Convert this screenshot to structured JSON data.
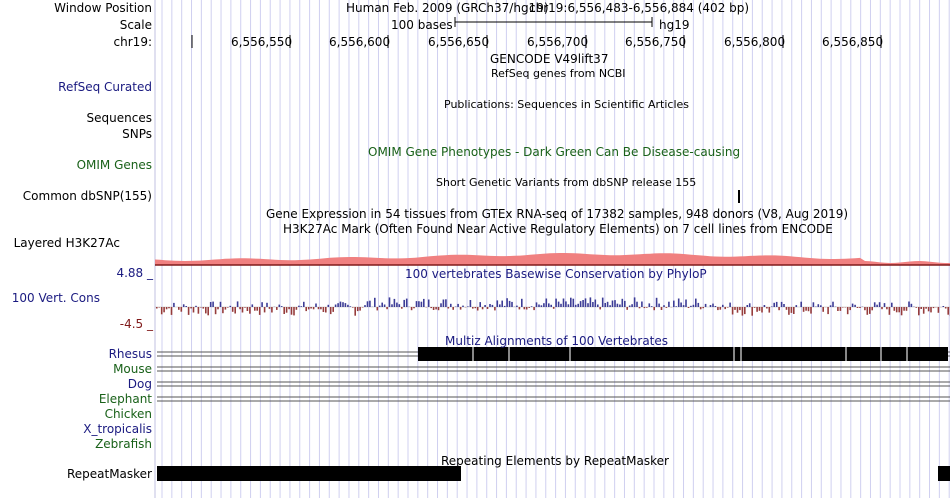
{
  "header": {
    "window_position_label": "Window Position",
    "scale_label": "Scale",
    "chrom_label": "chr19:",
    "assembly": "Human Feb. 2009 (GRCh37/hg19)",
    "position": "chr19:6,556,483-6,556,884 (402 bp)",
    "scale_text": "100 bases",
    "scale_db": "hg19",
    "ticks": [
      "6,556,550",
      "6,556,600",
      "6,556,650",
      "6,556,700",
      "6,556,750",
      "6,556,800",
      "6,556,850"
    ]
  },
  "tracks": {
    "gencode_title": "GENCODE V49lift37",
    "refseq_title": "RefSeq genes from NCBI",
    "refseq_label": "RefSeq Curated",
    "pubs_title": "Publications: Sequences in Scientific Articles",
    "sequences_label": "Sequences",
    "snps_label": "SNPs",
    "omim_title": "OMIM Gene Phenotypes - Dark Green Can Be Disease-causing",
    "omim_label": "OMIM Genes",
    "dbsnp_title": "Short Genetic Variants from dbSNP release 155",
    "dbsnp_label": "Common dbSNP(155)",
    "gtex_title": "Gene Expression in 54 tissues from GTEx RNA-seq of 17382 samples, 948 donors (V8, Aug 2019)",
    "h3k_title": "H3K27Ac Mark (Often Found Near Active Regulatory Elements) on 7 cell lines from ENCODE",
    "h3k_label": "Layered H3K27Ac",
    "cons_title": "100 vertebrates Basewise Conservation by PhyloP",
    "cons_label": "100 Vert. Cons",
    "cons_max": "4.88 _",
    "cons_min": "-4.5 _",
    "multiz_title": "Multiz Alignments of 100 Vertebrates",
    "species": [
      {
        "name": "Rhesus",
        "color": "#1a1a80"
      },
      {
        "name": "Mouse",
        "color": "#196119"
      },
      {
        "name": "Dog",
        "color": "#1a1a80"
      },
      {
        "name": "Elephant",
        "color": "#196119"
      },
      {
        "name": "Chicken",
        "color": "#196119"
      },
      {
        "name": "X_tropicalis",
        "color": "#1a1a80"
      },
      {
        "name": "Zebrafish",
        "color": "#196119"
      }
    ],
    "rmsk_title": "Repeating Elements by RepeatMasker",
    "rmsk_label": "RepeatMasker"
  },
  "colors": {
    "label_blue": "#1a1a80",
    "label_green": "#196119",
    "label_red": "#801a1a",
    "h3k_fill": "#f08080",
    "cons_pos": "#3c3c96",
    "cons_neg": "#963c3c",
    "grid": "#d0d0f0"
  }
}
